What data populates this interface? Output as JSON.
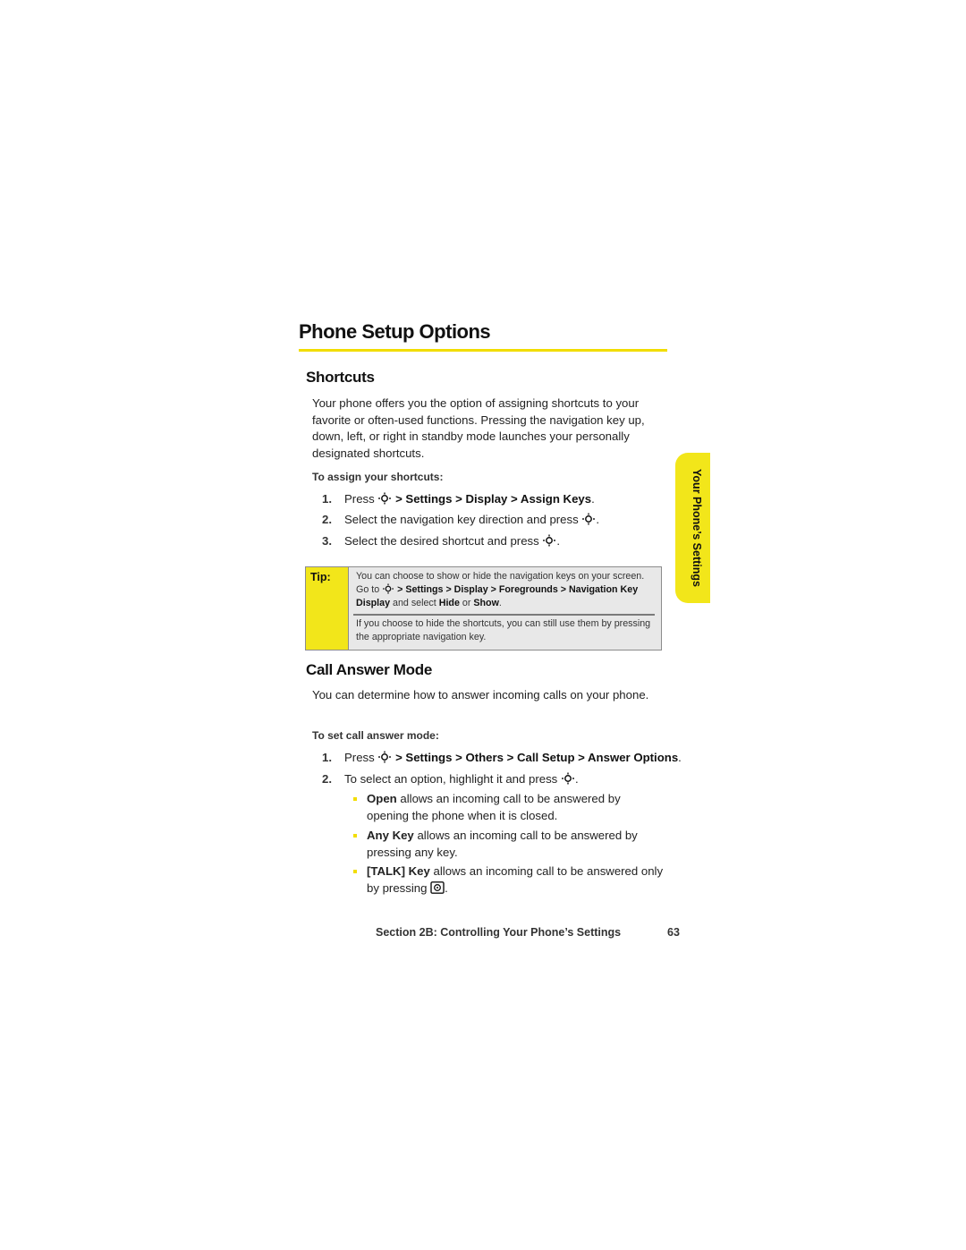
{
  "page": {
    "title": "Phone Setup Options",
    "side_tab": "Your Phone’s Settings",
    "footer": {
      "section": "Section 2B: Controlling Your Phone’s Settings",
      "page_number": "63"
    },
    "accent_color": "#f2dd00"
  },
  "shortcuts": {
    "heading": "Shortcuts",
    "intro": "Your phone offers you the option of assigning shortcuts to your favorite or often-used functions. Pressing the navigation key up, down, left, or right in standby mode launches your personally designated shortcuts.",
    "subheading": "To assign your shortcuts:",
    "steps": [
      {
        "num": "1.",
        "pre": "Press",
        "icon": "nav-key-icon",
        "path": "> Settings > Display > Assign Keys",
        "post": "."
      },
      {
        "num": "2.",
        "pre": "Select the navigation key direction and press",
        "icon": "nav-key-icon",
        "post": "."
      },
      {
        "num": "3.",
        "pre": "Select the desired shortcut and press",
        "icon": "nav-key-icon",
        "post": "."
      }
    ]
  },
  "tip": {
    "label": "Tip:",
    "line1_pre": "You can choose to show or hide the navigation keys on your screen. Go to",
    "line1_path": "> Settings > Display > Foregrounds > Navigation Key Display",
    "line1_mid": "and select",
    "hide": "Hide",
    "or": "or",
    "show": "Show",
    "line1_end": ".",
    "line2": "If you choose to hide the shortcuts, you can still use them by pressing the appropriate navigation key."
  },
  "call_answer": {
    "heading": "Call Answer Mode",
    "intro": "You can determine how to answer incoming calls on your phone.",
    "subheading": "To set call answer mode:",
    "steps": [
      {
        "num": "1.",
        "pre": "Press",
        "icon": "nav-key-icon",
        "path": "> Settings > Others > Call Setup > Answer Options",
        "post": "."
      },
      {
        "num": "2.",
        "pre": "To select an option, highlight it and press",
        "icon": "nav-key-icon",
        "post": "."
      }
    ],
    "options": [
      {
        "name": "Open",
        "desc": "allows an incoming call to be answered by opening the phone when it is closed."
      },
      {
        "name": "Any Key",
        "desc": "allows an incoming call to be answered by pressing any key."
      },
      {
        "name": "[TALK] Key",
        "desc": "allows an incoming call to be answered only by pressing",
        "icon": "talk-key-icon",
        "end": "."
      }
    ]
  }
}
